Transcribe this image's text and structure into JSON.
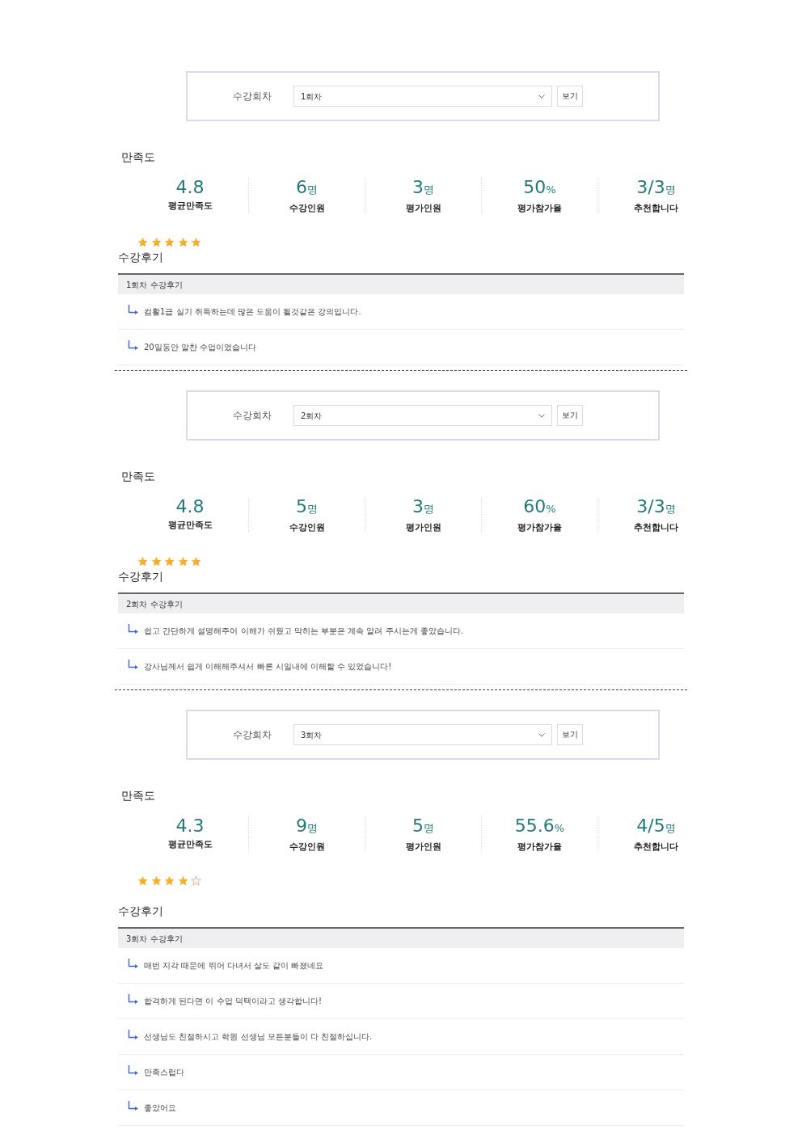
{
  "sections": [
    {
      "filter": {
        "label": "수강회차",
        "value": "1회차",
        "button": "보기"
      },
      "satisfaction": {
        "title": "만족도",
        "stats": [
          {
            "value": "4.8",
            "label": "평균만족도"
          },
          {
            "value": "6",
            "unit": "명",
            "label": "수강인원"
          },
          {
            "value": "3",
            "unit": "명",
            "label": "평가인원"
          },
          {
            "value": "50",
            "unit": "%",
            "label": "평가참가율"
          },
          {
            "value": "3/3",
            "unit": "명",
            "label": "추천합니다"
          }
        ],
        "stars": 5
      },
      "reviews": {
        "title": "수강후기",
        "header": "1회차 수강후기",
        "items": [
          "컴활1급 실기 취득하는데 많은 도움이 될것같은 강의입니다.",
          "20일동안 알찬 수업이었습니다"
        ]
      }
    },
    {
      "filter": {
        "label": "수강회차",
        "value": "2회차",
        "button": "보기"
      },
      "satisfaction": {
        "title": "만족도",
        "stats": [
          {
            "value": "4.8",
            "label": "평균만족도"
          },
          {
            "value": "5",
            "unit": "명",
            "label": "수강인원"
          },
          {
            "value": "3",
            "unit": "명",
            "label": "평가인원"
          },
          {
            "value": "60",
            "unit": "%",
            "label": "평가참가율"
          },
          {
            "value": "3/3",
            "unit": "명",
            "label": "추천합니다"
          }
        ],
        "stars": 5
      },
      "reviews": {
        "title": "수강후기",
        "header": "2회차 수강후기",
        "items": [
          "쉽고 간단하게 설명해주어 이해가 쉬웠고 막히는 부분은 계속 알려 주시는게 좋았습니다.",
          "강사님께서 쉽게 이해해주셔서 빠른 시일내에 이해할 수 있었습니다!"
        ]
      }
    },
    {
      "filter": {
        "label": "수강회차",
        "value": "3회차",
        "button": "보기"
      },
      "satisfaction": {
        "title": "만족도",
        "stats": [
          {
            "value": "4.3",
            "label": "평균만족도"
          },
          {
            "value": "9",
            "unit": "명",
            "label": "수강인원"
          },
          {
            "value": "5",
            "unit": "명",
            "label": "평가인원"
          },
          {
            "value": "55.6",
            "unit": "%",
            "label": "평가참가율"
          },
          {
            "value": "4/5",
            "unit": "명",
            "label": "추천합니다"
          }
        ],
        "stars": 4
      },
      "reviews": {
        "title": "수강후기",
        "header": "3회차 수강후기",
        "items": [
          "매번 지각 때문에 뛰어 다녀서 살도 같이 빠졌네요",
          "합격하게 된다면 이 수업 덕택이라고 생각합니다!",
          "선생님도 친절하시고 학원 선생님 모든분들이 다 친절하십니다.",
          "만족스럽다",
          "좋았어요"
        ]
      }
    }
  ]
}
